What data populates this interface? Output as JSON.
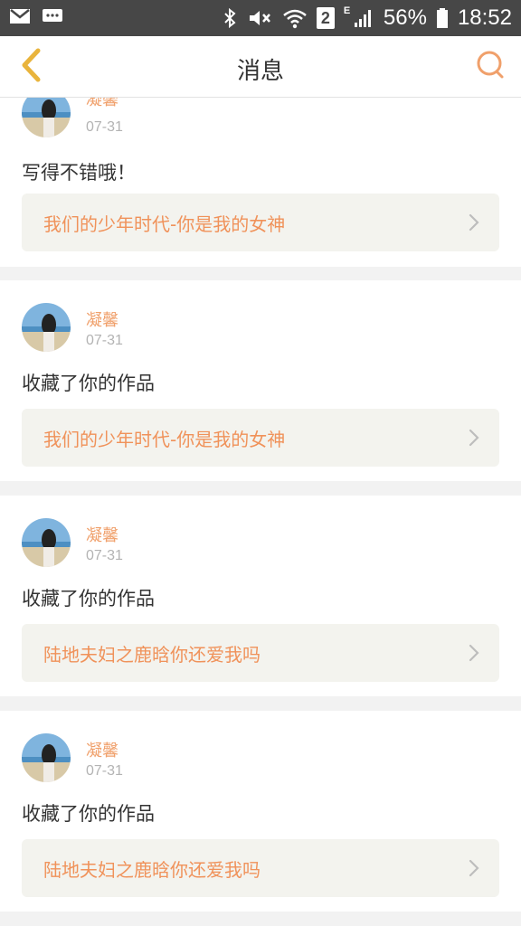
{
  "status_bar": {
    "sim_slot": "2",
    "network": "E",
    "battery_percent": "56%",
    "time": "18:52",
    "icons": [
      "mail-icon",
      "message-icon",
      "bluetooth-icon",
      "vibrate-icon",
      "wifi-icon",
      "sim-icon",
      "signal-icon",
      "battery-icon"
    ]
  },
  "header": {
    "title": "消息",
    "back_icon": "chevron-left-icon",
    "search_icon": "search-icon"
  },
  "colors": {
    "accent": "#f0a06b",
    "link_text": "#f0925a",
    "link_bg": "#f3f3ee",
    "status_bar_bg": "#474747"
  },
  "messages": [
    {
      "name": "凝馨",
      "date": "07-31",
      "content": "写得不错哦！",
      "work_title": "我们的少年时代-你是我的女神"
    },
    {
      "name": "凝馨",
      "date": "07-31",
      "content": "收藏了你的作品",
      "work_title": "我们的少年时代-你是我的女神"
    },
    {
      "name": "凝馨",
      "date": "07-31",
      "content": "收藏了你的作品",
      "work_title": "陆地夫妇之鹿晗你还爱我吗"
    },
    {
      "name": "凝馨",
      "date": "07-31",
      "content": "收藏了你的作品",
      "work_title": "陆地夫妇之鹿晗你还爱我吗"
    }
  ]
}
